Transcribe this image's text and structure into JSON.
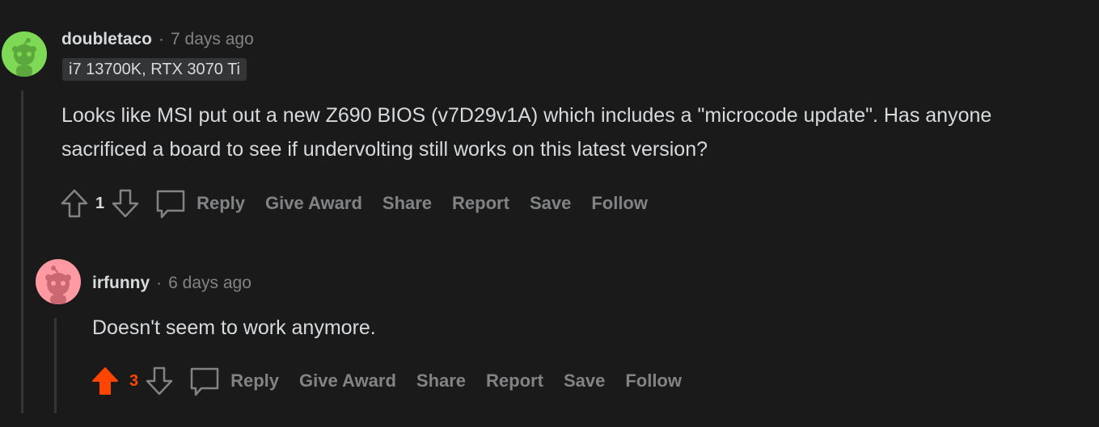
{
  "comments": [
    {
      "username": "doubletaco",
      "separator": "·",
      "time": "7 days ago",
      "flair": "i7 13700K, RTX 3070 Ti",
      "text": "Looks like MSI put out a new Z690 BIOS (v7D29v1A) which includes a \"microcode update\". Has anyone sacrificed a board to see if undervolting still works on this latest version?",
      "score": "1",
      "upvoted": false,
      "actions": {
        "reply": "Reply",
        "give_award": "Give Award",
        "share": "Share",
        "report": "Report",
        "save": "Save",
        "follow": "Follow"
      },
      "avatar_color": "#7ed957"
    },
    {
      "username": "irfunny",
      "separator": "·",
      "time": "6 days ago",
      "text": "Doesn't seem to work anymore.",
      "score": "3",
      "upvoted": true,
      "actions": {
        "reply": "Reply",
        "give_award": "Give Award",
        "share": "Share",
        "report": "Report",
        "save": "Save",
        "follow": "Follow"
      },
      "avatar_color": "#ff9aa2"
    }
  ],
  "colors": {
    "background": "#1a1a1b",
    "upvote_active": "#ff4500",
    "muted": "#818384",
    "text": "#d7dadc"
  }
}
